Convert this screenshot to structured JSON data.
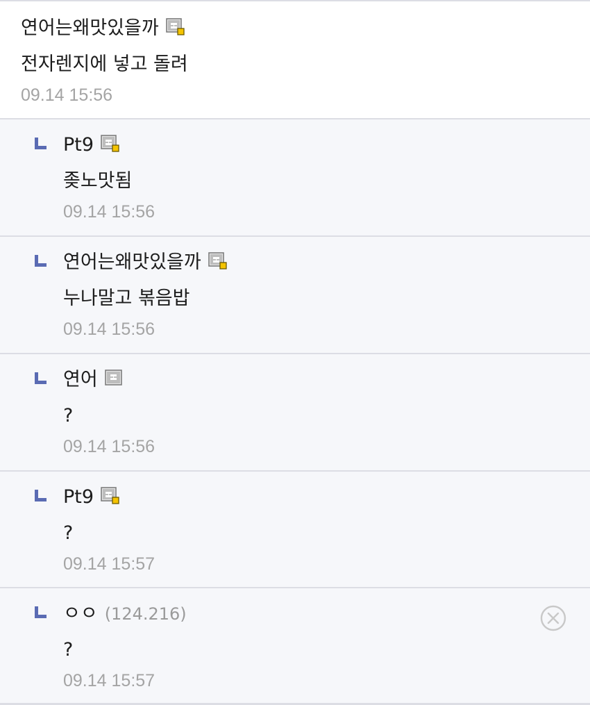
{
  "comments": [
    {
      "nick": "연어는왜맛있을까",
      "ip": "",
      "has_badge": true,
      "badge_icon": "gallery-member-icon",
      "text": "전자렌지에 넣고 돌려",
      "time": "09.14 15:56"
    },
    {
      "nick": "Pt9",
      "ip": "",
      "has_badge": true,
      "badge_icon": "gallery-member-icon",
      "text": "좆노맛됨",
      "time": "09.14 15:56"
    },
    {
      "nick": "연어는왜맛있을까",
      "ip": "",
      "has_badge": true,
      "badge_icon": "gallery-member-icon",
      "text": "누나말고 볶음밥",
      "time": "09.14 15:56"
    },
    {
      "nick": "연어",
      "ip": "",
      "has_badge": true,
      "badge_icon": "fixed-member-icon",
      "text": "?",
      "time": "09.14 15:56"
    },
    {
      "nick": "Pt9",
      "ip": "",
      "has_badge": true,
      "badge_icon": "gallery-member-icon",
      "text": "?",
      "time": "09.14 15:57"
    },
    {
      "nick": "ㅇㅇ",
      "ip": "(124.216)",
      "has_badge": false,
      "text": "?",
      "time": "09.14 15:57",
      "delete_icon": "close-circle-icon"
    }
  ],
  "colors": {
    "reply_arrow": "#5a6bb3",
    "time": "#a4a4a4",
    "reply_bg": "#f6f7fa",
    "divider": "#dcdde4"
  }
}
